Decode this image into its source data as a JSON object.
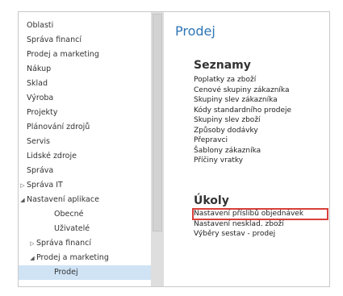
{
  "sidebar": {
    "items": [
      {
        "label": "Oblasti",
        "arrow": "",
        "level": 0,
        "selected": false
      },
      {
        "label": "Správa financí",
        "arrow": "",
        "level": 0,
        "selected": false
      },
      {
        "label": "Prodej a marketing",
        "arrow": "",
        "level": 0,
        "selected": false
      },
      {
        "label": "Nákup",
        "arrow": "",
        "level": 0,
        "selected": false
      },
      {
        "label": "Sklad",
        "arrow": "",
        "level": 0,
        "selected": false
      },
      {
        "label": "Výroba",
        "arrow": "",
        "level": 0,
        "selected": false
      },
      {
        "label": "Projekty",
        "arrow": "",
        "level": 0,
        "selected": false
      },
      {
        "label": "Plánování zdrojů",
        "arrow": "",
        "level": 0,
        "selected": false
      },
      {
        "label": "Servis",
        "arrow": "",
        "level": 0,
        "selected": false
      },
      {
        "label": "Lidské zdroje",
        "arrow": "",
        "level": 0,
        "selected": false
      },
      {
        "label": "Správa",
        "arrow": "",
        "level": 0,
        "selected": false
      },
      {
        "label": "Správa IT",
        "arrow": "▷",
        "level": 0,
        "selected": false
      },
      {
        "label": "Nastavení aplikace",
        "arrow": "◢",
        "level": 0,
        "selected": false
      },
      {
        "label": "Obecné",
        "arrow": "",
        "level": 2,
        "selected": false
      },
      {
        "label": "Uživatelé",
        "arrow": "",
        "level": 2,
        "selected": false
      },
      {
        "label": "Správa financí",
        "arrow": "▷",
        "level": 1,
        "selected": false
      },
      {
        "label": "Prodej a marketing",
        "arrow": "◢",
        "level": 1,
        "selected": false
      },
      {
        "label": "Prodej",
        "arrow": "",
        "level": 2,
        "selected": true
      }
    ]
  },
  "content": {
    "title": "Prodej",
    "lists_heading": "Seznamy",
    "lists": [
      "Poplatky za zboží",
      "Cenové skupiny zákazníka",
      "Skupiny slev zákazníka",
      "Kódy standardního prodeje",
      "Skupiny slev zboží",
      "Způsoby dodávky",
      "Přepravci",
      "Šablony zákazníka",
      "Příčiny vratky"
    ],
    "tasks_heading": "Úkoly",
    "tasks": [
      "Nastavení příslibů objednávek",
      "Nastavení nesklad. zboží",
      "Výběry sestav - prodej"
    ]
  },
  "colors": {
    "accent": "#2e75b6",
    "highlight": "#d9403a",
    "selection": "#cfe3f5"
  }
}
